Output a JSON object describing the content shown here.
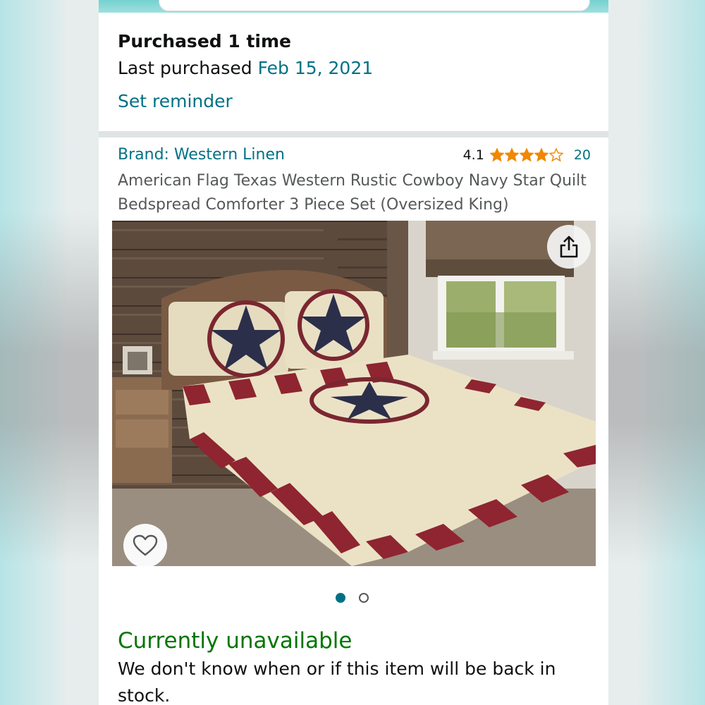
{
  "purchase": {
    "count_text": "Purchased 1 time",
    "last_label": "Last purchased",
    "last_date": "Feb 15, 2021",
    "reminder_link": "Set reminder"
  },
  "product": {
    "brand": "Brand: Western Linen",
    "rating": "4.1",
    "rating_value": 4.1,
    "stars_max": 5,
    "review_count": "20",
    "title": "American Flag Texas Western Rustic Cowboy Navy Star Quilt Bedspread Comforter 3 Piece Set (Oversized King)"
  },
  "gallery": {
    "image_count": 2,
    "active_index": 0,
    "share_icon": "share-icon",
    "favorite_icon": "heart-icon"
  },
  "availability": {
    "status": "Currently unavailable",
    "message": "We don't know when or if this item will be back in stock."
  },
  "colors": {
    "link": "#007185",
    "unavailable": "#007600",
    "star": "#f08804"
  }
}
